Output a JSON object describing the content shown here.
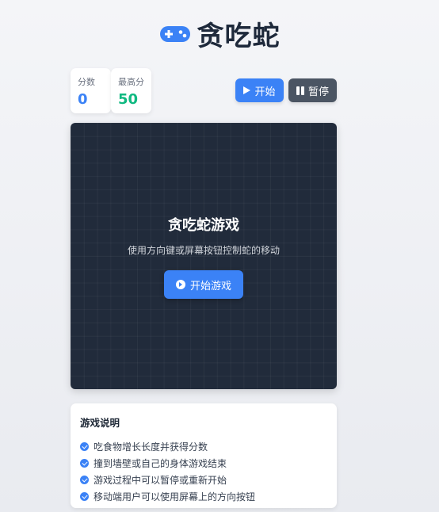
{
  "header": {
    "title": "贪吃蛇",
    "icon": "gamepad-icon"
  },
  "scores": {
    "score_label": "分数",
    "score_value": "0",
    "high_label": "最高分",
    "high_value": "50"
  },
  "controls": {
    "start_label": "开始",
    "pause_label": "暂停"
  },
  "board": {
    "overlay_title": "贪吃蛇游戏",
    "overlay_subtitle": "使用方向键或屏幕按钮控制蛇的移动",
    "start_game_label": "开始游戏"
  },
  "instructions": {
    "title": "游戏说明",
    "rules": [
      "吃食物增长长度并获得分数",
      "撞到墙壁或自己的身体游戏结束",
      "游戏过程中可以暂停或重新开始",
      "移动端用户可以使用屏幕上的方向按钮"
    ]
  },
  "colors": {
    "accent": "#3b82f6",
    "high_score": "#10b981",
    "board_bg": "#212b3b",
    "pause_btn": "#4b5563"
  }
}
